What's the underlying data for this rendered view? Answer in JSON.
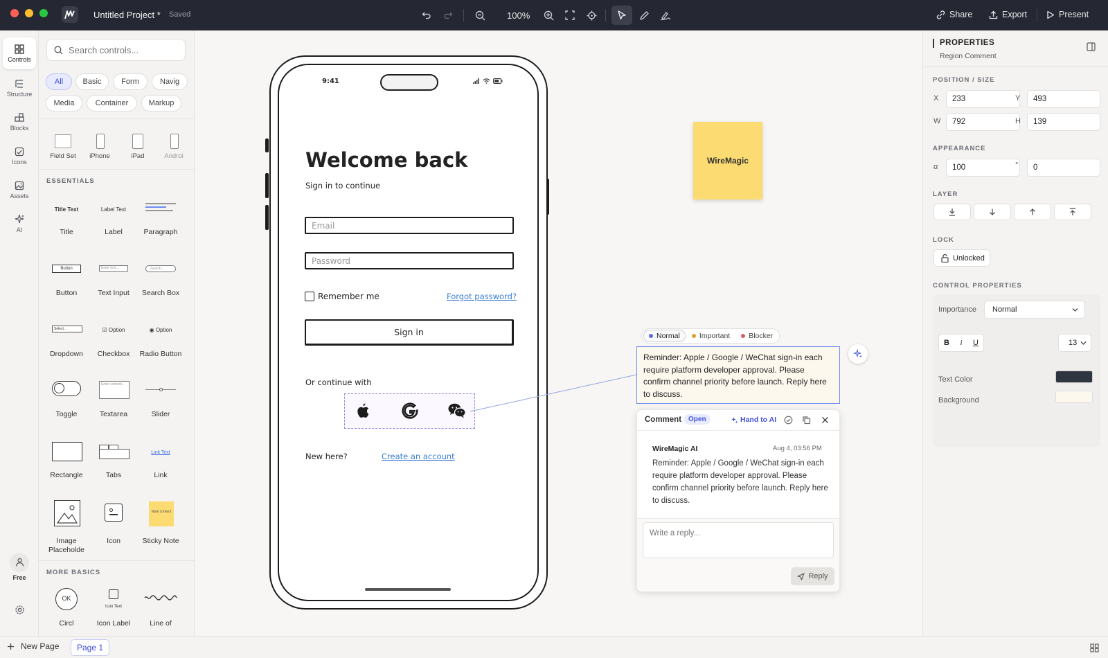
{
  "window": {
    "title": "Untitled Project *",
    "status": "Saved",
    "zoom": "100%"
  },
  "toolbar": {
    "share": "Share",
    "export": "Export",
    "present": "Present"
  },
  "rail": [
    {
      "label": "Controls"
    },
    {
      "label": "Structure"
    },
    {
      "label": "Blocks"
    },
    {
      "label": "Icons"
    },
    {
      "label": "Assets"
    },
    {
      "label": "AI"
    }
  ],
  "rail_bottom": {
    "plan": "Free"
  },
  "controls": {
    "search_placeholder": "Search controls...",
    "filters": [
      "All",
      "Basic",
      "Form",
      "Navig",
      "Media",
      "Container",
      "Markup"
    ],
    "devices": [
      "Field Set",
      "iPhone",
      "iPad",
      "Androi"
    ],
    "essentials_title": "ESSENTIALS",
    "essentials": [
      {
        "label": "Title",
        "preview": "Title Text"
      },
      {
        "label": "Label",
        "preview": "Label Text"
      },
      {
        "label": "Paragraph",
        "preview": ""
      },
      {
        "label": "Button",
        "preview": "Button"
      },
      {
        "label": "Text Input",
        "preview": "Enter text..."
      },
      {
        "label": "Search Box",
        "preview": "Search..."
      },
      {
        "label": "Dropdown",
        "preview": "Select..."
      },
      {
        "label": "Checkbox",
        "preview": "Option"
      },
      {
        "label": "Radio Button",
        "preview": "Option"
      },
      {
        "label": "Toggle",
        "preview": ""
      },
      {
        "label": "Textarea",
        "preview": "Enter content..."
      },
      {
        "label": "Slider",
        "preview": ""
      },
      {
        "label": "Rectangle",
        "preview": ""
      },
      {
        "label": "Tabs",
        "preview": ""
      },
      {
        "label": "Link",
        "preview": "Link Text"
      },
      {
        "label": "Image Placeholde",
        "preview": ""
      },
      {
        "label": "Icon",
        "preview": ""
      },
      {
        "label": "Sticky Note",
        "preview": "Note content"
      }
    ],
    "more_title": "MORE BASICS",
    "more": [
      {
        "label": "Circl",
        "preview": "OK"
      },
      {
        "label": "Icon Label",
        "preview": "Icon Text"
      },
      {
        "label": "Line of",
        "preview": ""
      }
    ]
  },
  "phone": {
    "time": "9:41",
    "heading": "Welcome back",
    "subheading": "Sign in to continue",
    "email_placeholder": "Email",
    "password_placeholder": "Password",
    "remember": "Remember me",
    "forgot": "Forgot password?",
    "signin": "Sign in",
    "continue_with": "Or continue with",
    "new_here": "New here?",
    "create_account": "Create an account"
  },
  "sticky": {
    "text": "WireMagic"
  },
  "comment": {
    "priorities": [
      {
        "label": "Normal",
        "color": "#5b6ee1"
      },
      {
        "label": "Important",
        "color": "#e0a030"
      },
      {
        "label": "Blocker",
        "color": "#e06060"
      }
    ],
    "note": "Reminder: Apple / Google / WeChat sign-in each require platform developer approval. Please confirm channel priority before launch. Reply here to discuss.",
    "header": "Comment",
    "status": "Open",
    "hand_to_ai": "Hand to AI",
    "author": "WireMagic AI",
    "time": "Aug 4, 03:56 PM",
    "body": "Reminder: Apple / Google / WeChat sign-in each require platform developer approval. Please confirm channel priority before launch. Reply here to discuss.",
    "reply_placeholder": "Write a reply...",
    "reply_button": "Reply"
  },
  "properties": {
    "title": "PROPERTIES",
    "subtitle": "Region Comment",
    "position_title": "POSITION / SIZE",
    "x_label": "X",
    "x": "233",
    "y_label": "Y",
    "y": "493",
    "w_label": "W",
    "w": "792",
    "h_label": "H",
    "h": "139",
    "appearance_title": "APPEARANCE",
    "alpha_label": "α",
    "alpha": "100",
    "rotation_label": "°",
    "rotation": "0",
    "layer_title": "LAYER",
    "lock_title": "LOCK",
    "lock_value": "Unlocked",
    "control_title": "CONTROL PROPERTIES",
    "importance_label": "Importance",
    "importance_value": "Normal",
    "bold": "B",
    "italic": "i",
    "underline": "U",
    "font_size": "13",
    "text_color_label": "Text Color",
    "text_color": "#2f3441",
    "background_label": "Background",
    "background": "#fdf8ee"
  },
  "pages": {
    "new_page": "New Page",
    "current": "Page 1"
  }
}
